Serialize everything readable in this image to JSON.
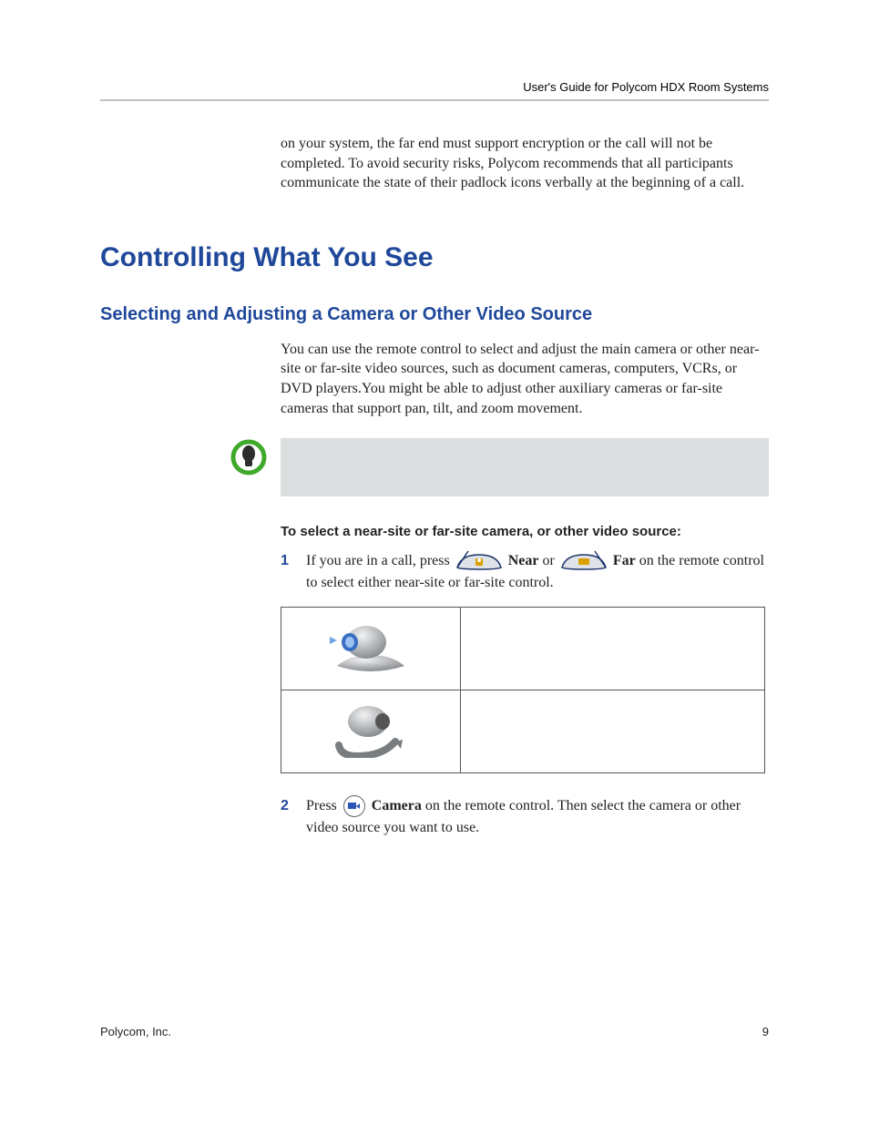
{
  "header": {
    "running_title": "User's Guide for Polycom HDX Room Systems"
  },
  "intro_continued": "on your system, the far end must support encryption or the call will not be completed. To avoid security risks, Polycom recommends that all participants communicate the state of their padlock icons verbally at the beginning of a call.",
  "h1": "Controlling What You See",
  "h2": "Selecting and Adjusting a Camera or Other Video Source",
  "body1": "You can use the remote control to select and adjust the main camera or other near-site or far-site video sources, such as document cameras, computers, VCRs, or DVD players.You might be able to adjust other auxiliary cameras or far-site cameras that support pan, tilt, and zoom movement.",
  "proc_head": "To select a near-site or far-site camera, or other video source:",
  "step1": {
    "num": "1",
    "t1": "If you are in a call, press ",
    "near_label": "Near",
    "t2": " or ",
    "far_label": "Far",
    "t3": " on the remote control to select either near-site or far-site control."
  },
  "icons": {
    "near_button_name": "near-button-icon",
    "far_button_name": "far-button-icon",
    "note_icon_name": "tip-icon"
  },
  "table": {
    "row1_desc": "",
    "row2_desc": ""
  },
  "step2": {
    "num": "2",
    "t1": "Press ",
    "camera_label": "Camera",
    "t2": " on the remote control. Then select the camera or other video source you want to use."
  },
  "footer": {
    "left": "Polycom, Inc.",
    "page_number": "9"
  }
}
